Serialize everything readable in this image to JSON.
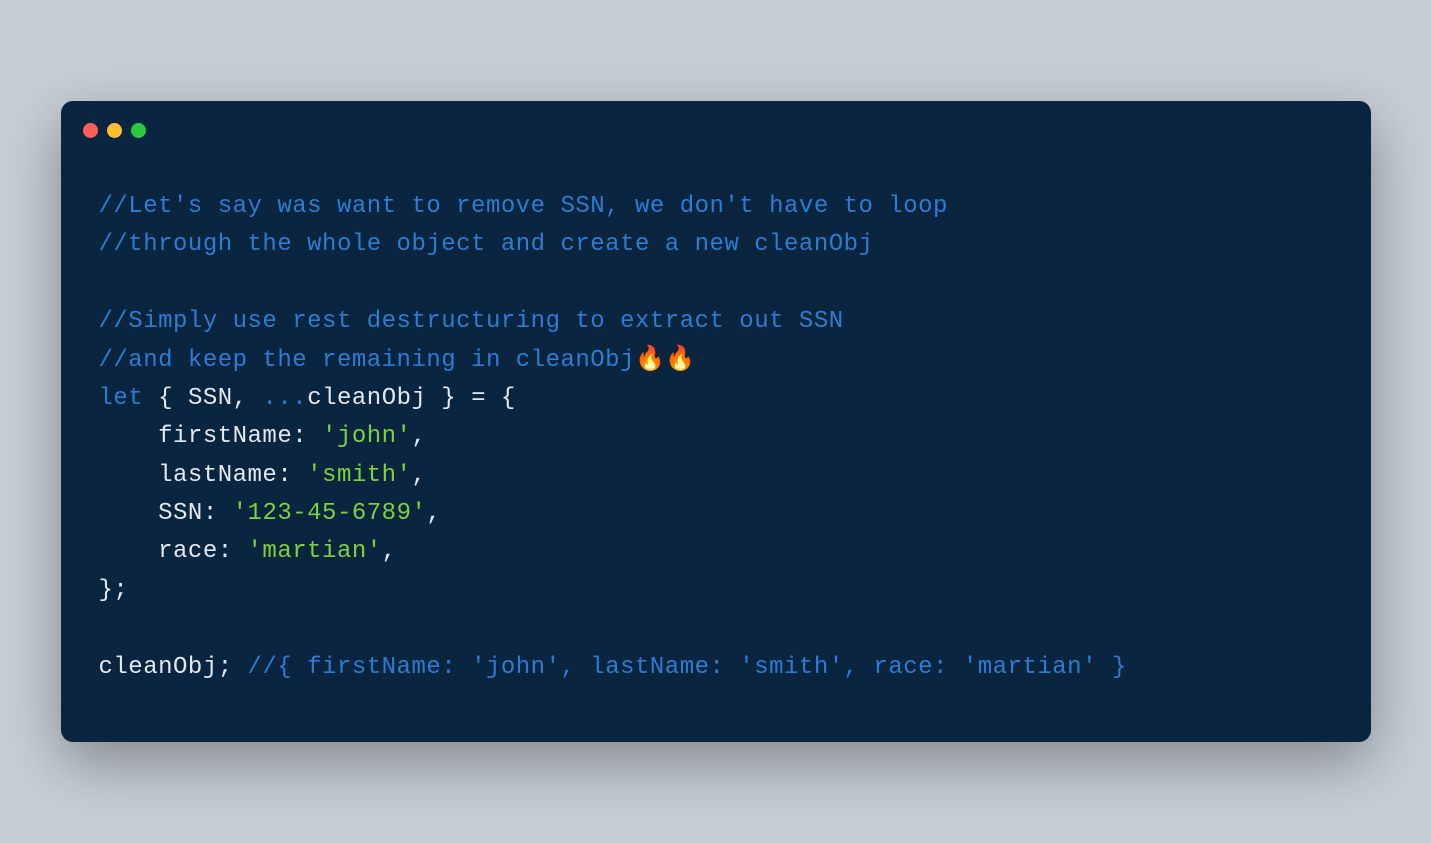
{
  "window": {
    "controls": {
      "red": "#ff5f56",
      "yellow": "#ffbd2e",
      "green": "#27c93f"
    }
  },
  "code": {
    "lines": [
      {
        "tokens": [
          {
            "type": "comment",
            "text": "//Let's say was want to remove SSN, we don't have to loop"
          }
        ]
      },
      {
        "tokens": [
          {
            "type": "comment",
            "text": "//through the whole object and create a new cleanObj"
          }
        ]
      },
      {
        "tokens": []
      },
      {
        "tokens": [
          {
            "type": "comment",
            "text": "//Simply use rest destructuring to extract out SSN"
          }
        ]
      },
      {
        "tokens": [
          {
            "type": "comment",
            "text": "//and keep the remaining in cleanObj🔥🔥"
          }
        ]
      },
      {
        "tokens": [
          {
            "type": "keyword",
            "text": "let"
          },
          {
            "type": "punct",
            "text": " { "
          },
          {
            "type": "ident",
            "text": "SSN"
          },
          {
            "type": "punct",
            "text": ", "
          },
          {
            "type": "spread",
            "text": "..."
          },
          {
            "type": "ident",
            "text": "cleanObj"
          },
          {
            "type": "punct",
            "text": " } = {"
          }
        ]
      },
      {
        "tokens": [
          {
            "type": "punct",
            "text": "    "
          },
          {
            "type": "prop",
            "text": "firstName"
          },
          {
            "type": "punct",
            "text": ": "
          },
          {
            "type": "string",
            "text": "'john'"
          },
          {
            "type": "punct",
            "text": ","
          }
        ]
      },
      {
        "tokens": [
          {
            "type": "punct",
            "text": "    "
          },
          {
            "type": "prop",
            "text": "lastName"
          },
          {
            "type": "punct",
            "text": ": "
          },
          {
            "type": "string",
            "text": "'smith'"
          },
          {
            "type": "punct",
            "text": ","
          }
        ]
      },
      {
        "tokens": [
          {
            "type": "punct",
            "text": "    "
          },
          {
            "type": "prop",
            "text": "SSN"
          },
          {
            "type": "punct",
            "text": ": "
          },
          {
            "type": "string",
            "text": "'123-45-6789'"
          },
          {
            "type": "punct",
            "text": ","
          }
        ]
      },
      {
        "tokens": [
          {
            "type": "punct",
            "text": "    "
          },
          {
            "type": "prop",
            "text": "race"
          },
          {
            "type": "punct",
            "text": ": "
          },
          {
            "type": "string",
            "text": "'martian'"
          },
          {
            "type": "punct",
            "text": ","
          }
        ]
      },
      {
        "tokens": [
          {
            "type": "punct",
            "text": "};"
          }
        ]
      },
      {
        "tokens": []
      },
      {
        "tokens": [
          {
            "type": "ident",
            "text": "cleanObj"
          },
          {
            "type": "punct",
            "text": "; "
          },
          {
            "type": "comment",
            "text": "//{ firstName: 'john', lastName: 'smith', race: 'martian' }"
          }
        ]
      }
    ]
  }
}
